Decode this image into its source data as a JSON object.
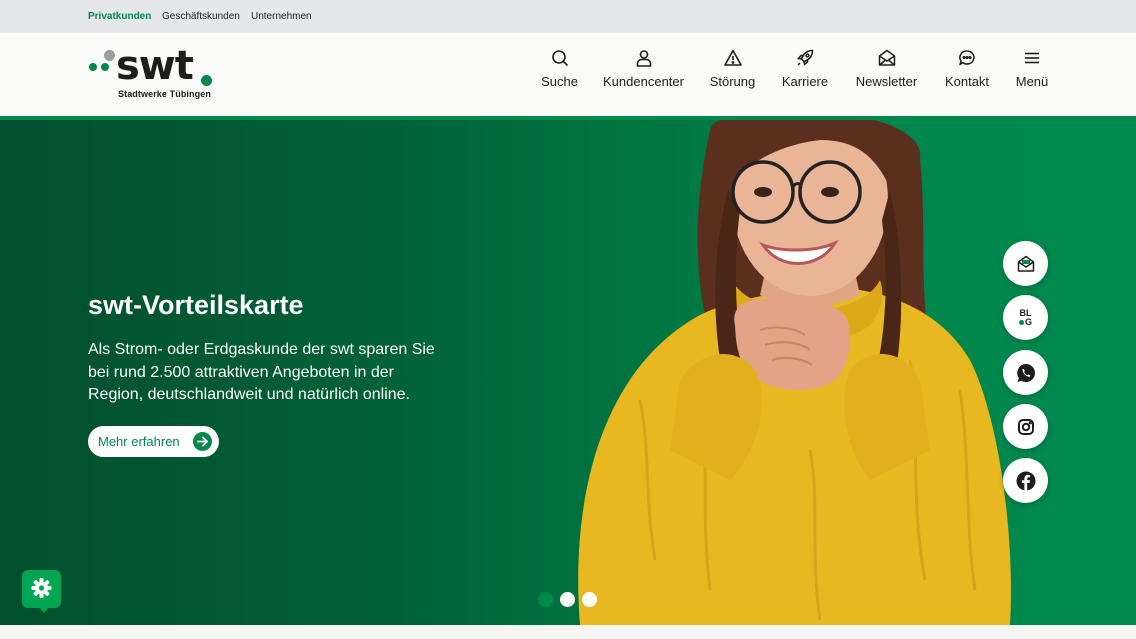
{
  "topbar": {
    "links": [
      "Privatkunden",
      "Geschäftskunden",
      "Unternehmen"
    ]
  },
  "logo": {
    "word": "swt",
    "subtitle": "Stadtwerke Tübingen"
  },
  "nav": {
    "items": [
      {
        "label": "Suche",
        "icon": "search-icon"
      },
      {
        "label": "Kundencenter",
        "icon": "user-icon"
      },
      {
        "label": "Störung",
        "icon": "warning-icon"
      },
      {
        "label": "Karriere",
        "icon": "rocket-icon"
      },
      {
        "label": "Newsletter",
        "icon": "envelope-icon"
      },
      {
        "label": "Kontakt",
        "icon": "chat-icon"
      },
      {
        "label": "Menü",
        "icon": "hamburger-icon"
      }
    ]
  },
  "hero": {
    "title": "swt-Vorteilskarte",
    "text": "Als Strom- oder Erdgaskunde der swt sparen Sie bei rund 2.500 attraktiven Angeboten in der Region, deutschlandweit und natürlich online.",
    "button": "Mehr erfahren"
  },
  "social": {
    "blog_label_top": "BL",
    "blog_label_bottom": "G",
    "items": [
      "newsletter-icon",
      "blog-icon",
      "whatsapp-icon",
      "instagram-icon",
      "facebook-icon"
    ]
  },
  "slider": {
    "count": 3,
    "active_index": 0
  },
  "colors": {
    "brand_green": "#00894b",
    "dark_green": "#014f2c",
    "topbar_bg": "#e6e7eb",
    "sweater_yellow": "#e8b821"
  }
}
